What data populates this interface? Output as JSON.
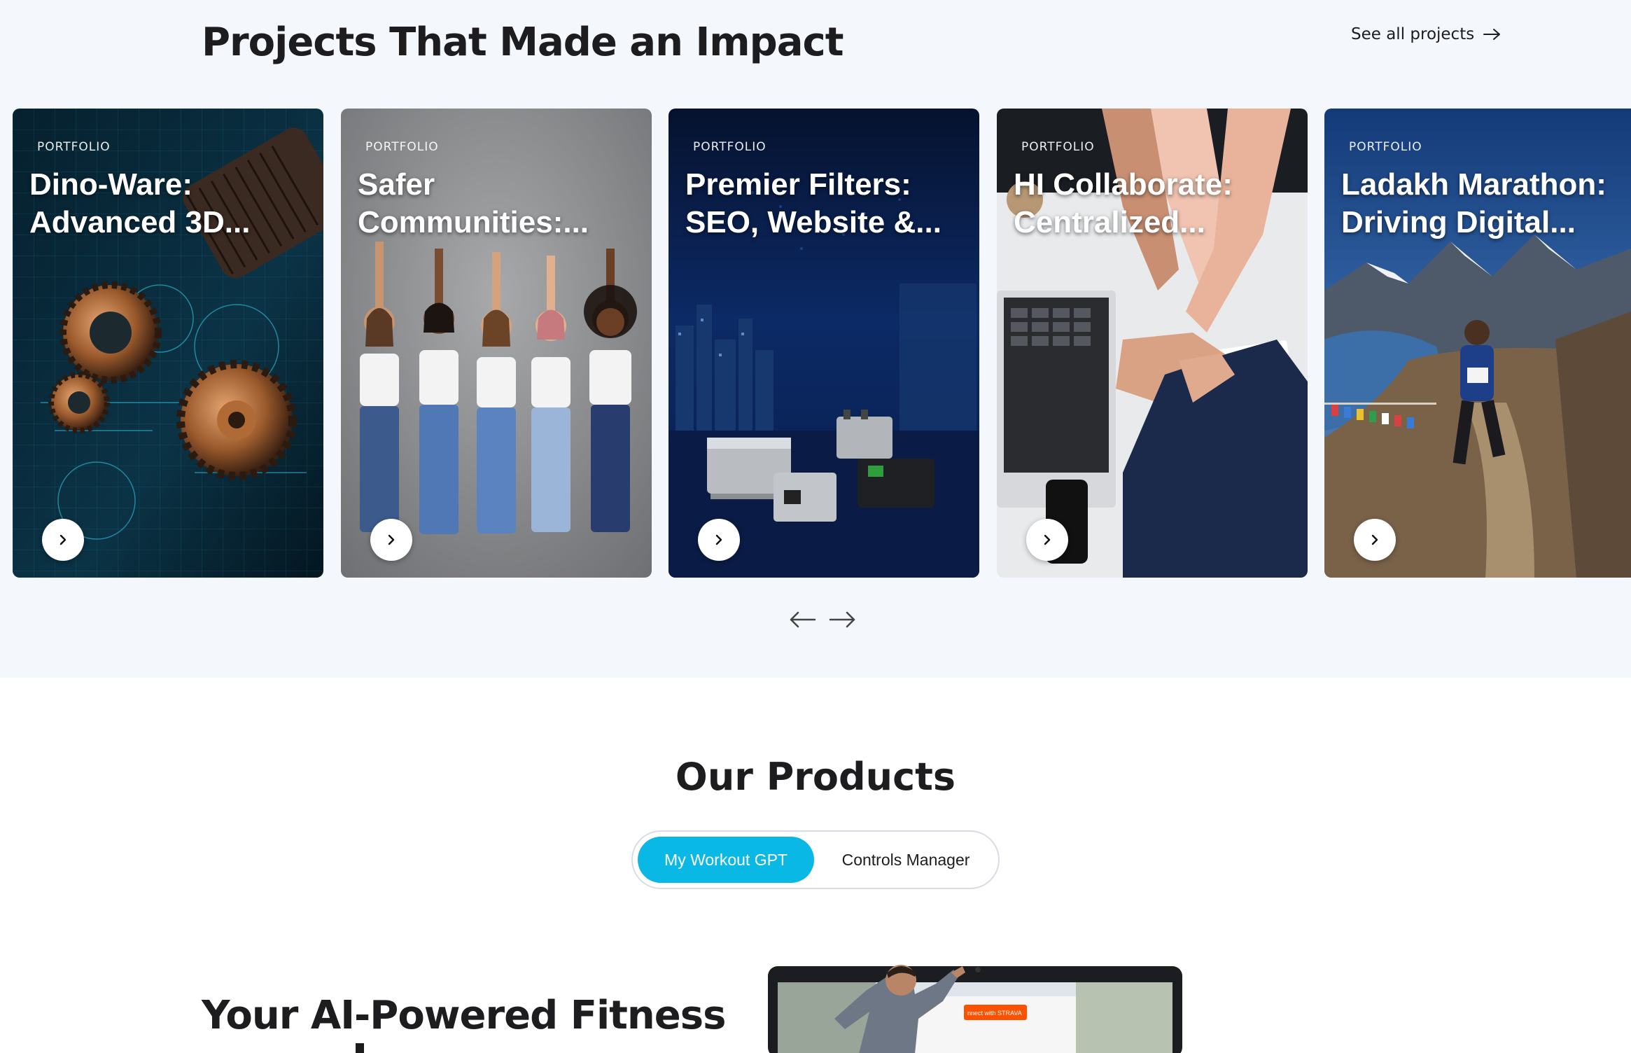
{
  "projects": {
    "title": "Projects That Made an Impact",
    "see_all_label": "See all projects",
    "cards": [
      {
        "tag": "PORTFOLIO",
        "title": "Dino-Ware: Advanced 3D..."
      },
      {
        "tag": "PORTFOLIO",
        "title": "Safer Communities:..."
      },
      {
        "tag": "PORTFOLIO",
        "title": "Premier Filters: SEO, Website &..."
      },
      {
        "tag": "PORTFOLIO",
        "title": "HI Collaborate: Centralized..."
      },
      {
        "tag": "PORTFOLIO",
        "title": "Ladakh Marathon: Driving Digital..."
      }
    ]
  },
  "products": {
    "title": "Our Products",
    "tabs": [
      {
        "label": "My Workout GPT",
        "active": true
      },
      {
        "label": "Controls Manager",
        "active": false
      }
    ],
    "hero_heading": "Your AI-Powered Fitness",
    "badge_text": "nnect with STRAVA"
  },
  "colors": {
    "accent": "#0ab8e6",
    "section_bg": "#f4f7fc",
    "title_text": "#1d1d1f"
  },
  "icons": {
    "see_all": "arrow-right-icon",
    "card_button": "chevron-right-icon",
    "prev": "arrow-left-icon",
    "next": "arrow-right-icon"
  }
}
